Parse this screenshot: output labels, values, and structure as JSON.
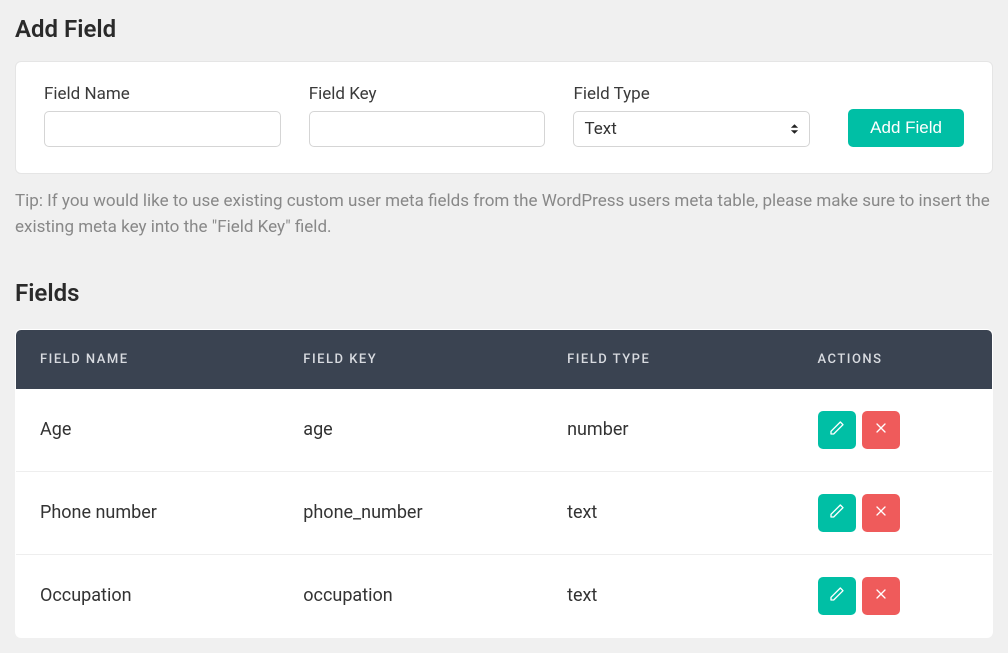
{
  "addField": {
    "heading": "Add Field",
    "labels": {
      "name": "Field Name",
      "key": "Field Key",
      "type": "Field Type"
    },
    "typeValue": "Text",
    "button": "Add Field"
  },
  "tip": "Tip: If you would like to use existing custom user meta fields from the WordPress users meta table, please make sure to insert the existing meta key into the \"Field Key\" field.",
  "fields": {
    "heading": "Fields",
    "columns": {
      "name": "FIELD NAME",
      "key": "FIELD KEY",
      "type": "FIELD TYPE",
      "actions": "ACTIONS"
    },
    "rows": [
      {
        "name": "Age",
        "key": "age",
        "type": "number"
      },
      {
        "name": "Phone number",
        "key": "phone_number",
        "type": "text"
      },
      {
        "name": "Occupation",
        "key": "occupation",
        "type": "text"
      }
    ]
  }
}
